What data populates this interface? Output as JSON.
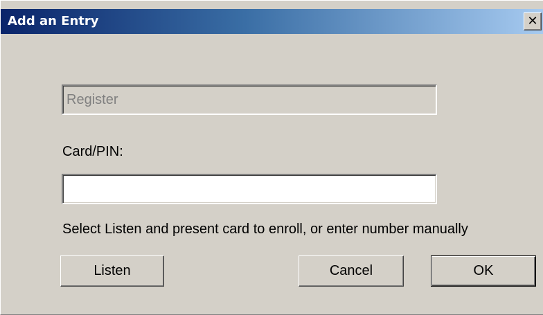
{
  "window": {
    "title": "Add an Entry",
    "close_glyph": "✕"
  },
  "form": {
    "register_field": {
      "value": "Register",
      "enabled": false
    },
    "card_label": "Card/PIN:",
    "card_field": {
      "value": "",
      "placeholder": ""
    },
    "hint": "Select Listen and present card to enroll, or enter number manually"
  },
  "buttons": {
    "listen": "Listen",
    "cancel": "Cancel",
    "ok": "OK"
  },
  "colors": {
    "titlebar_start": "#0a246a",
    "titlebar_end": "#a6caf0",
    "face": "#d4d0c8"
  },
  "icons": {
    "close": "close-icon"
  }
}
